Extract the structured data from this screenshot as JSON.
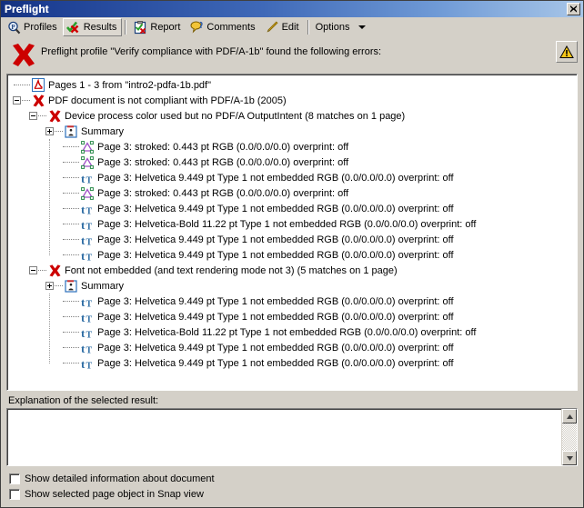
{
  "window": {
    "title": "Preflight",
    "close_label": "Close"
  },
  "toolbar": {
    "items": [
      {
        "label": "Profiles",
        "icon": "magnifier-p-icon",
        "active": false
      },
      {
        "label": "Results",
        "icon": "check-x-icon",
        "active": true
      },
      {
        "label": "Report",
        "icon": "clipboard-icon",
        "active": false
      },
      {
        "label": "Comments",
        "icon": "comment-icon",
        "active": false
      },
      {
        "label": "Edit",
        "icon": "pencil-icon",
        "active": false
      },
      {
        "label": "Options",
        "icon": "",
        "active": false
      }
    ]
  },
  "message": {
    "icon": "red-x-icon",
    "text": "Preflight profile \"Verify compliance with PDF/A-1b\" found the following errors:",
    "warning_button": "warning-triangle-icon"
  },
  "tree": {
    "rows": [
      {
        "level": 0,
        "toggle": "none",
        "icon": "pdf-file-icon",
        "label": "Pages 1 - 3 from \"intro2-pdfa-1b.pdf\""
      },
      {
        "level": 0,
        "toggle": "collapse",
        "icon": "red-x-icon",
        "label": "PDF document is not compliant with PDF/A-1b (2005)"
      },
      {
        "level": 1,
        "toggle": "collapse",
        "icon": "red-x-icon",
        "label": "Device process color used but no PDF/A OutputIntent (8 matches on 1 page)"
      },
      {
        "level": 2,
        "toggle": "expand",
        "icon": "summary-icon",
        "label": "Summary"
      },
      {
        "level": 3,
        "toggle": "none",
        "icon": "stroked-path-icon",
        "label": "Page 3:  stroked: 0.443 pt RGB (0.0/0.0/0.0)  overprint: off"
      },
      {
        "level": 3,
        "toggle": "none",
        "icon": "stroked-path-icon",
        "label": "Page 3:  stroked: 0.443 pt RGB (0.0/0.0/0.0)  overprint: off"
      },
      {
        "level": 3,
        "toggle": "none",
        "icon": "text-tt-icon",
        "label": "Page 3: Helvetica 9.449 pt Type 1 not embedded RGB (0.0/0.0/0.0)  overprint: off"
      },
      {
        "level": 3,
        "toggle": "none",
        "icon": "stroked-path-icon",
        "label": "Page 3:  stroked: 0.443 pt RGB (0.0/0.0/0.0)  overprint: off"
      },
      {
        "level": 3,
        "toggle": "none",
        "icon": "text-tt-icon",
        "label": "Page 3: Helvetica 9.449 pt Type 1 not embedded RGB (0.0/0.0/0.0)  overprint: off"
      },
      {
        "level": 3,
        "toggle": "none",
        "icon": "text-tt-icon",
        "label": "Page 3: Helvetica-Bold 11.22 pt Type 1 not embedded RGB (0.0/0.0/0.0)  overprint: off"
      },
      {
        "level": 3,
        "toggle": "none",
        "icon": "text-tt-icon",
        "label": "Page 3: Helvetica 9.449 pt Type 1 not embedded RGB (0.0/0.0/0.0)  overprint: off"
      },
      {
        "level": 3,
        "toggle": "none",
        "icon": "text-tt-icon",
        "label": "Page 3: Helvetica 9.449 pt Type 1 not embedded RGB (0.0/0.0/0.0)  overprint: off"
      },
      {
        "level": 1,
        "toggle": "collapse",
        "icon": "red-x-icon",
        "label": "Font not embedded (and text rendering mode not 3) (5 matches on 1 page)"
      },
      {
        "level": 2,
        "toggle": "expand",
        "icon": "summary-icon",
        "label": "Summary"
      },
      {
        "level": 3,
        "toggle": "none",
        "icon": "text-tt-icon",
        "label": "Page 3: Helvetica 9.449 pt Type 1 not embedded RGB (0.0/0.0/0.0)  overprint: off"
      },
      {
        "level": 3,
        "toggle": "none",
        "icon": "text-tt-icon",
        "label": "Page 3: Helvetica 9.449 pt Type 1 not embedded RGB (0.0/0.0/0.0)  overprint: off"
      },
      {
        "level": 3,
        "toggle": "none",
        "icon": "text-tt-icon",
        "label": "Page 3: Helvetica-Bold 11.22 pt Type 1 not embedded RGB (0.0/0.0/0.0)  overprint: off"
      },
      {
        "level": 3,
        "toggle": "none",
        "icon": "text-tt-icon",
        "label": "Page 3: Helvetica 9.449 pt Type 1 not embedded RGB (0.0/0.0/0.0)  overprint: off"
      },
      {
        "level": 3,
        "toggle": "none",
        "icon": "text-tt-icon",
        "label": "Page 3: Helvetica 9.449 pt Type 1 not embedded RGB (0.0/0.0/0.0)  overprint: off"
      }
    ]
  },
  "explanation": {
    "label": "Explanation of the selected result:",
    "value": "",
    "scroll_up": "scroll-up-arrow",
    "scroll_down": "scroll-down-arrow"
  },
  "options": {
    "checkboxes": [
      {
        "label": "Show detailed information about document",
        "checked": false
      },
      {
        "label": "Show selected page object in Snap view",
        "checked": false
      }
    ]
  },
  "colors": {
    "window_bg": "#d4d0c8",
    "title_start": "#14307d",
    "title_end": "#a8c6e8",
    "error_red": "#cc0000",
    "text_icon_blue": "#2e6da4",
    "warning_yellow": "#f5c518"
  }
}
